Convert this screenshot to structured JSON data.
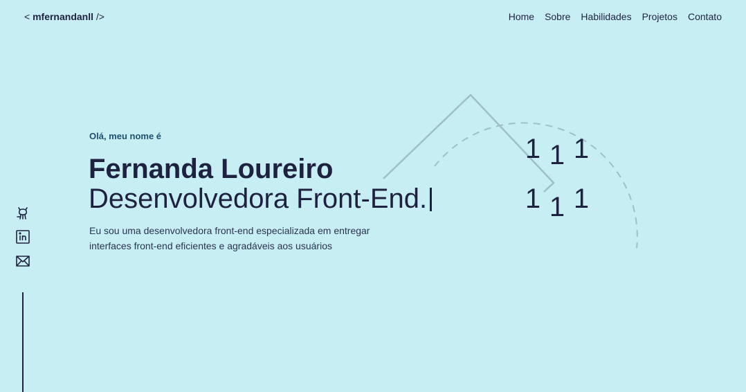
{
  "header": {
    "logo_prefix": "<",
    "logo_name": "mfernandanll",
    "logo_suffix": "/>",
    "nav": [
      "Home",
      "Sobre",
      "Habilidades",
      "Projetos",
      "Contato"
    ]
  },
  "hero": {
    "greeting": "Olá, meu nome é",
    "name": "Fernanda Loureiro",
    "role": "Desenvolvedora Front-End.",
    "description": "Eu sou uma desenvolvedora front-end especializada em entregar interfaces front-end eficientes e agradáveis aos usuários"
  },
  "illustration": {
    "digits": [
      "1",
      "1",
      "1",
      "1",
      "1",
      "1"
    ]
  },
  "social": {
    "icons": [
      "github-icon",
      "linkedin-icon",
      "mail-icon"
    ]
  },
  "colors": {
    "background": "#c7eff3",
    "text": "#1e2240",
    "accent": "#1f4f6e",
    "decoration": "#9fbfc6"
  }
}
